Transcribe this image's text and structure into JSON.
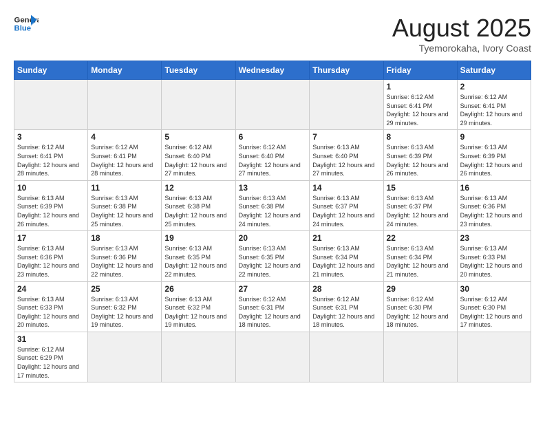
{
  "logo": {
    "line1": "General",
    "line2": "Blue"
  },
  "title": "August 2025",
  "location": "Tyemorokaha, Ivory Coast",
  "days_header": [
    "Sunday",
    "Monday",
    "Tuesday",
    "Wednesday",
    "Thursday",
    "Friday",
    "Saturday"
  ],
  "weeks": [
    [
      {
        "day": "",
        "info": ""
      },
      {
        "day": "",
        "info": ""
      },
      {
        "day": "",
        "info": ""
      },
      {
        "day": "",
        "info": ""
      },
      {
        "day": "",
        "info": ""
      },
      {
        "day": "1",
        "info": "Sunrise: 6:12 AM\nSunset: 6:41 PM\nDaylight: 12 hours and 29 minutes."
      },
      {
        "day": "2",
        "info": "Sunrise: 6:12 AM\nSunset: 6:41 PM\nDaylight: 12 hours and 29 minutes."
      }
    ],
    [
      {
        "day": "3",
        "info": "Sunrise: 6:12 AM\nSunset: 6:41 PM\nDaylight: 12 hours and 28 minutes."
      },
      {
        "day": "4",
        "info": "Sunrise: 6:12 AM\nSunset: 6:41 PM\nDaylight: 12 hours and 28 minutes."
      },
      {
        "day": "5",
        "info": "Sunrise: 6:12 AM\nSunset: 6:40 PM\nDaylight: 12 hours and 27 minutes."
      },
      {
        "day": "6",
        "info": "Sunrise: 6:12 AM\nSunset: 6:40 PM\nDaylight: 12 hours and 27 minutes."
      },
      {
        "day": "7",
        "info": "Sunrise: 6:13 AM\nSunset: 6:40 PM\nDaylight: 12 hours and 27 minutes."
      },
      {
        "day": "8",
        "info": "Sunrise: 6:13 AM\nSunset: 6:39 PM\nDaylight: 12 hours and 26 minutes."
      },
      {
        "day": "9",
        "info": "Sunrise: 6:13 AM\nSunset: 6:39 PM\nDaylight: 12 hours and 26 minutes."
      }
    ],
    [
      {
        "day": "10",
        "info": "Sunrise: 6:13 AM\nSunset: 6:39 PM\nDaylight: 12 hours and 26 minutes."
      },
      {
        "day": "11",
        "info": "Sunrise: 6:13 AM\nSunset: 6:38 PM\nDaylight: 12 hours and 25 minutes."
      },
      {
        "day": "12",
        "info": "Sunrise: 6:13 AM\nSunset: 6:38 PM\nDaylight: 12 hours and 25 minutes."
      },
      {
        "day": "13",
        "info": "Sunrise: 6:13 AM\nSunset: 6:38 PM\nDaylight: 12 hours and 24 minutes."
      },
      {
        "day": "14",
        "info": "Sunrise: 6:13 AM\nSunset: 6:37 PM\nDaylight: 12 hours and 24 minutes."
      },
      {
        "day": "15",
        "info": "Sunrise: 6:13 AM\nSunset: 6:37 PM\nDaylight: 12 hours and 24 minutes."
      },
      {
        "day": "16",
        "info": "Sunrise: 6:13 AM\nSunset: 6:36 PM\nDaylight: 12 hours and 23 minutes."
      }
    ],
    [
      {
        "day": "17",
        "info": "Sunrise: 6:13 AM\nSunset: 6:36 PM\nDaylight: 12 hours and 23 minutes."
      },
      {
        "day": "18",
        "info": "Sunrise: 6:13 AM\nSunset: 6:36 PM\nDaylight: 12 hours and 22 minutes."
      },
      {
        "day": "19",
        "info": "Sunrise: 6:13 AM\nSunset: 6:35 PM\nDaylight: 12 hours and 22 minutes."
      },
      {
        "day": "20",
        "info": "Sunrise: 6:13 AM\nSunset: 6:35 PM\nDaylight: 12 hours and 22 minutes."
      },
      {
        "day": "21",
        "info": "Sunrise: 6:13 AM\nSunset: 6:34 PM\nDaylight: 12 hours and 21 minutes."
      },
      {
        "day": "22",
        "info": "Sunrise: 6:13 AM\nSunset: 6:34 PM\nDaylight: 12 hours and 21 minutes."
      },
      {
        "day": "23",
        "info": "Sunrise: 6:13 AM\nSunset: 6:33 PM\nDaylight: 12 hours and 20 minutes."
      }
    ],
    [
      {
        "day": "24",
        "info": "Sunrise: 6:13 AM\nSunset: 6:33 PM\nDaylight: 12 hours and 20 minutes."
      },
      {
        "day": "25",
        "info": "Sunrise: 6:13 AM\nSunset: 6:32 PM\nDaylight: 12 hours and 19 minutes."
      },
      {
        "day": "26",
        "info": "Sunrise: 6:13 AM\nSunset: 6:32 PM\nDaylight: 12 hours and 19 minutes."
      },
      {
        "day": "27",
        "info": "Sunrise: 6:12 AM\nSunset: 6:31 PM\nDaylight: 12 hours and 18 minutes."
      },
      {
        "day": "28",
        "info": "Sunrise: 6:12 AM\nSunset: 6:31 PM\nDaylight: 12 hours and 18 minutes."
      },
      {
        "day": "29",
        "info": "Sunrise: 6:12 AM\nSunset: 6:30 PM\nDaylight: 12 hours and 18 minutes."
      },
      {
        "day": "30",
        "info": "Sunrise: 6:12 AM\nSunset: 6:30 PM\nDaylight: 12 hours and 17 minutes."
      }
    ],
    [
      {
        "day": "31",
        "info": "Sunrise: 6:12 AM\nSunset: 6:29 PM\nDaylight: 12 hours and 17 minutes."
      },
      {
        "day": "",
        "info": ""
      },
      {
        "day": "",
        "info": ""
      },
      {
        "day": "",
        "info": ""
      },
      {
        "day": "",
        "info": ""
      },
      {
        "day": "",
        "info": ""
      },
      {
        "day": "",
        "info": ""
      }
    ]
  ]
}
